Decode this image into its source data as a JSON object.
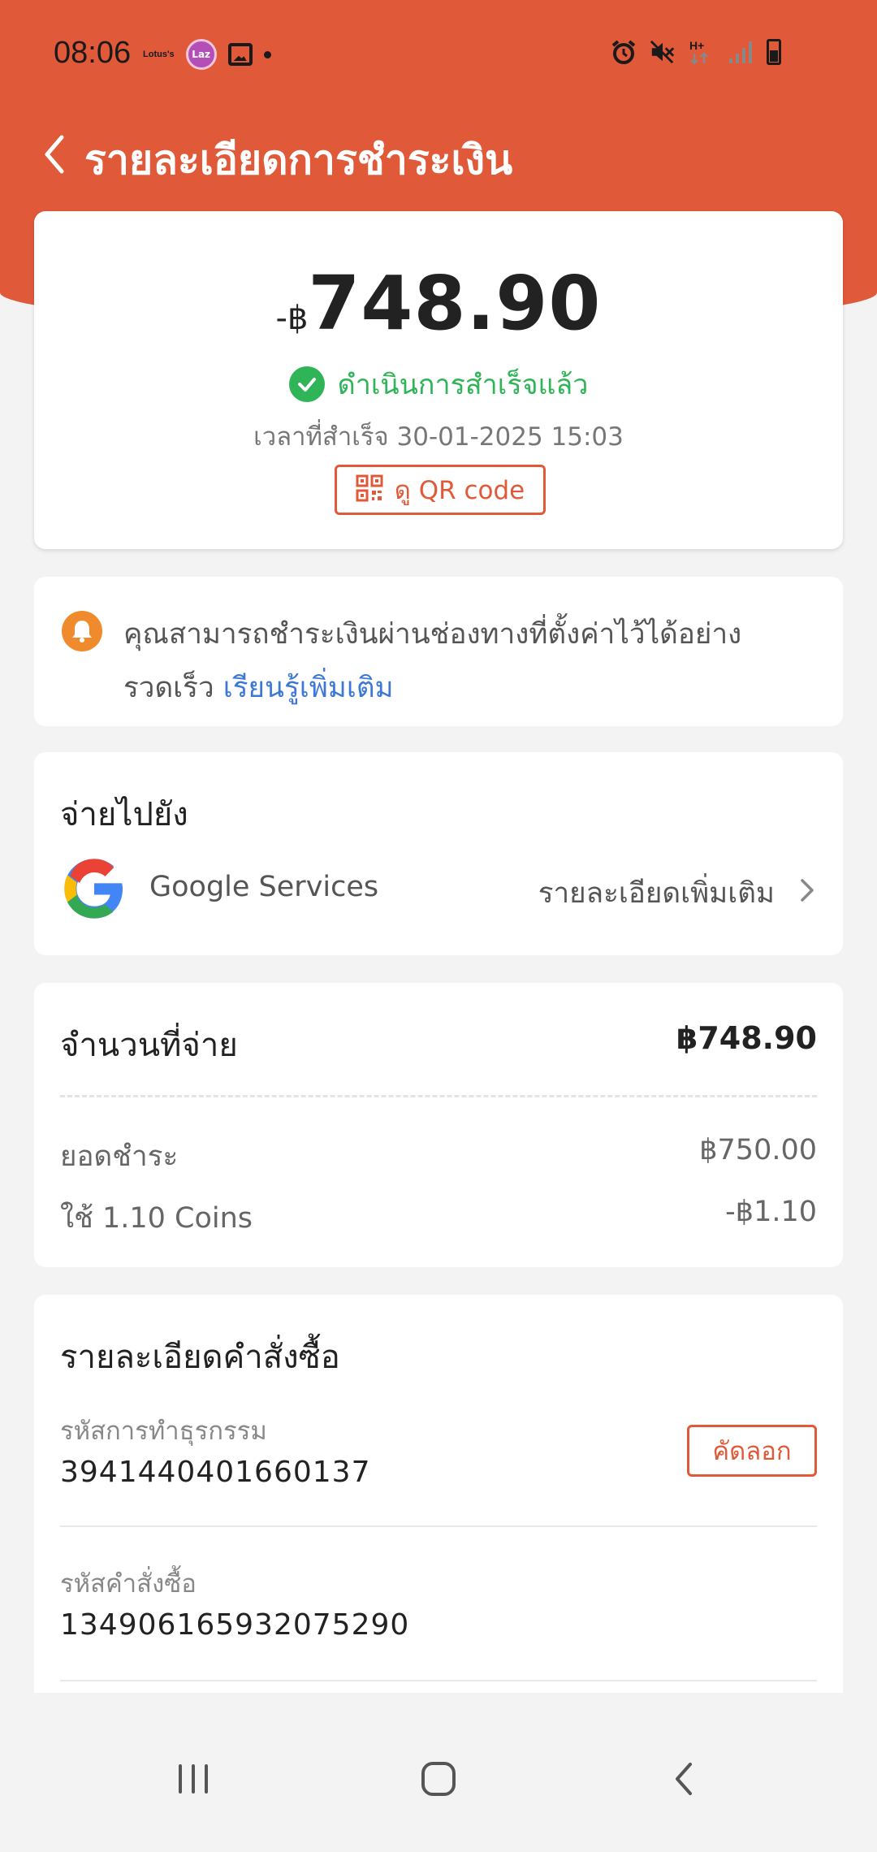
{
  "status_bar": {
    "time": "08:06",
    "lotus_label": "Lotus's",
    "laz_label": "Laz",
    "icons": [
      "lotus-icon",
      "laz-app-icon",
      "gallery-icon",
      "dot-icon",
      "alarm-icon",
      "mute-icon",
      "network-hplus-icon",
      "signal-icon",
      "battery-icon"
    ]
  },
  "header": {
    "title": "รายละเอียดการชำระเงิน"
  },
  "summary": {
    "prefix": "-฿",
    "amount": "748.90",
    "status": "ดำเนินการสำเร็จแล้ว",
    "time": "เวลาที่สำเร็จ 30-01-2025 15:03",
    "qr_button": "ดู QR code"
  },
  "notice": {
    "text": "คุณสามารถชำระเงินผ่านช่องทางที่ตั้งค่าไว้ได้อย่างรวดเร็ว",
    "link": "เรียนรู้เพิ่มเติม"
  },
  "pay_to": {
    "title": "จ่ายไปยัง",
    "merchant": "Google Services",
    "more": "รายละเอียดเพิ่มเติม"
  },
  "amount_detail": {
    "paid_label": "จำนวนที่จ่าย",
    "paid_value": "฿748.90",
    "rows": [
      {
        "label": "ยอดชำระ",
        "value": "฿750.00"
      },
      {
        "label": "ใช้ 1.10 Coins",
        "value": "-฿1.10"
      }
    ]
  },
  "order": {
    "title": "รายละเอียดคำสั่งซื้อ",
    "transaction_label": "รหัสการทำธุรกรรม",
    "transaction_id": "3941440401660137",
    "copy_button": "คัดลอก",
    "order_label": "รหัสคำสั่งซื้อ",
    "order_id": "134906165932075290"
  },
  "colors": {
    "brand": "#e05a3a",
    "success": "#2fb457",
    "link": "#3d78d6",
    "bell": "#ef8b2c"
  },
  "nav": {
    "icons": [
      "recent-apps-icon",
      "home-icon",
      "back-icon"
    ]
  }
}
